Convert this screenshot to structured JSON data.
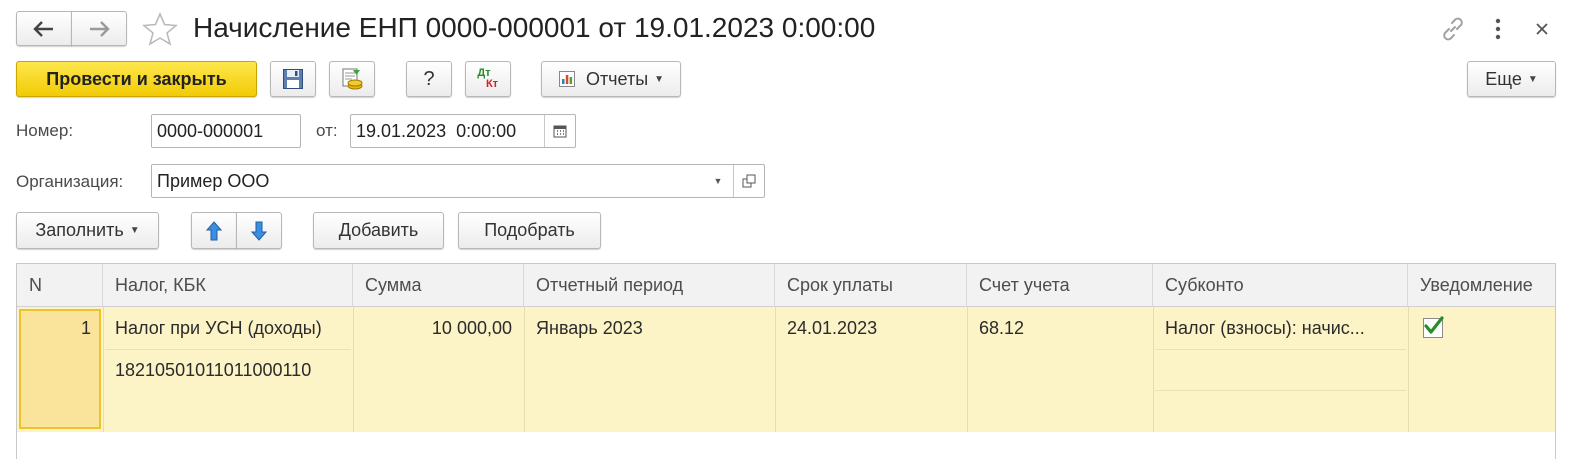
{
  "window": {
    "title": "Начисление ЕНП 0000-000001 от 19.01.2023 0:00:00"
  },
  "toolbar": {
    "post_close_label": "Провести и закрыть",
    "help_label": "?",
    "dtkt_top": "Дт",
    "dtkt_bottom": "Кт",
    "reports_label": "Отчеты",
    "more_label": "Еще"
  },
  "form": {
    "number_label": "Номер:",
    "number_value": "0000-000001",
    "date_label": "от:",
    "date_value": "19.01.2023  0:00:00",
    "org_label": "Организация:",
    "org_value": "Пример ООО"
  },
  "table_toolbar": {
    "fill_label": "Заполнить",
    "add_label": "Добавить",
    "pick_label": "Подобрать"
  },
  "table": {
    "columns": [
      "N",
      "Налог, КБК",
      "Сумма",
      "Отчетный период",
      "Срок уплаты",
      "Счет учета",
      "Субконто",
      "Уведомление"
    ],
    "rows": [
      {
        "n": "1",
        "tax": "Налог при УСН (доходы)",
        "kbk": "18210501011011000110",
        "sum": "10 000,00",
        "period": "Январь 2023",
        "due": "24.01.2023",
        "account": "68.12",
        "subconto": "Налог (взносы): начис...",
        "notice_checked": true
      }
    ]
  },
  "colors": {
    "primary_button": "#f5d21a",
    "row_selected": "#fcf3c7",
    "current_cell": "#fae39a",
    "check": "#2a8b2a"
  }
}
